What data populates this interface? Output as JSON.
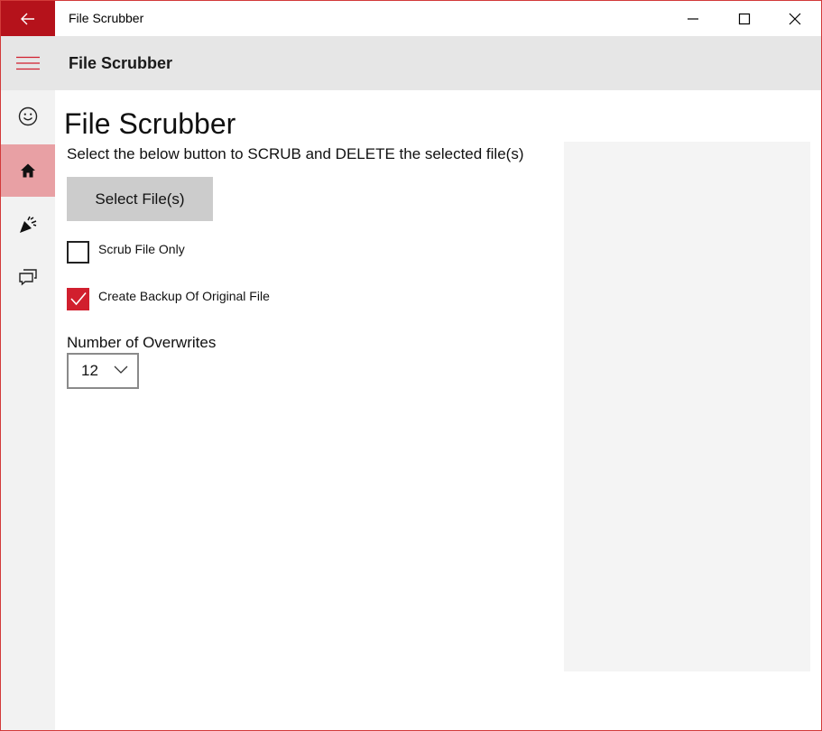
{
  "window": {
    "title": "File Scrubber"
  },
  "appbar": {
    "title": "File Scrubber"
  },
  "rail": {
    "items": [
      {
        "icon": "smiley-icon"
      },
      {
        "icon": "home-icon",
        "selected": true
      },
      {
        "icon": "party-popper-icon"
      },
      {
        "icon": "chat-icon"
      }
    ]
  },
  "main": {
    "page_title": "File Scrubber",
    "instructions": "Select the below button to SCRUB and DELETE the selected file(s)",
    "select_button_label": "Select File(s)",
    "scrub_only": {
      "label": "Scrub File Only",
      "checked": false
    },
    "create_backup": {
      "label": "Create Backup Of Original File",
      "checked": true
    },
    "overwrites": {
      "label": "Number of Overwrites",
      "value": "12"
    }
  },
  "colors": {
    "accent": "#b5121b",
    "rail_selected": "#e8a0a4",
    "checkbox_checked": "#d11f2e",
    "appbar_bg": "#e6e6e6"
  }
}
